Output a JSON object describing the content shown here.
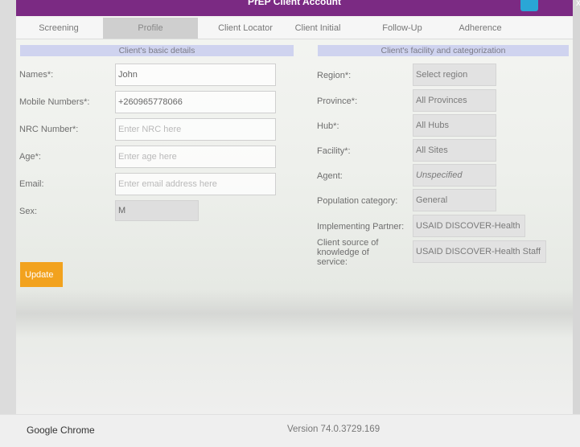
{
  "window": {
    "title": "PrEP Client Account",
    "close_glyph": "x"
  },
  "tabs": [
    {
      "label": "Screening"
    },
    {
      "label": "Profile"
    },
    {
      "label": "Client Locator"
    },
    {
      "label": "Client Initial"
    },
    {
      "label": "Follow-Up"
    },
    {
      "label": "Adherence"
    }
  ],
  "active_tab": "Profile",
  "basic_details": {
    "header": "Client's basic details",
    "fields": [
      {
        "label": "Names*:",
        "value": "John",
        "placeholder": ""
      },
      {
        "label": "Mobile Numbers*:",
        "value": "+260965778066",
        "placeholder": ""
      },
      {
        "label": "NRC Number*:",
        "value": "",
        "placeholder": "Enter NRC here"
      },
      {
        "label": "Age*:",
        "value": "",
        "placeholder": "Enter age here"
      },
      {
        "label": "Email:",
        "value": "",
        "placeholder": "Enter email address here"
      },
      {
        "label": "Sex:",
        "value": "M",
        "placeholder": ""
      }
    ]
  },
  "facility": {
    "header": "Client's facility and categorization",
    "fields": [
      {
        "label": "Region*:",
        "value": "Select region"
      },
      {
        "label": "Province*:",
        "value": "All Provinces"
      },
      {
        "label": "Hub*:",
        "value": "All Hubs"
      },
      {
        "label": "Facility*:",
        "value": "All Sites"
      },
      {
        "label": "Agent:",
        "value": "Unspecified"
      },
      {
        "label": "Population category:",
        "value": "General"
      },
      {
        "label": "Implementing Partner:",
        "value": "USAID DISCOVER-Health"
      },
      {
        "label": "Client source of knowledge of service:",
        "value": "USAID DISCOVER-Health Staff"
      }
    ]
  },
  "actions": {
    "update_label": "Update"
  },
  "footer": {
    "browser": "Google Chrome",
    "version": "Version 74.0.3729.169"
  },
  "colors": {
    "titlebar": "#7b2a83",
    "section_header": "#cfd3ef",
    "update_button": "#f2a21e",
    "title_button": "#2aa6d6"
  }
}
